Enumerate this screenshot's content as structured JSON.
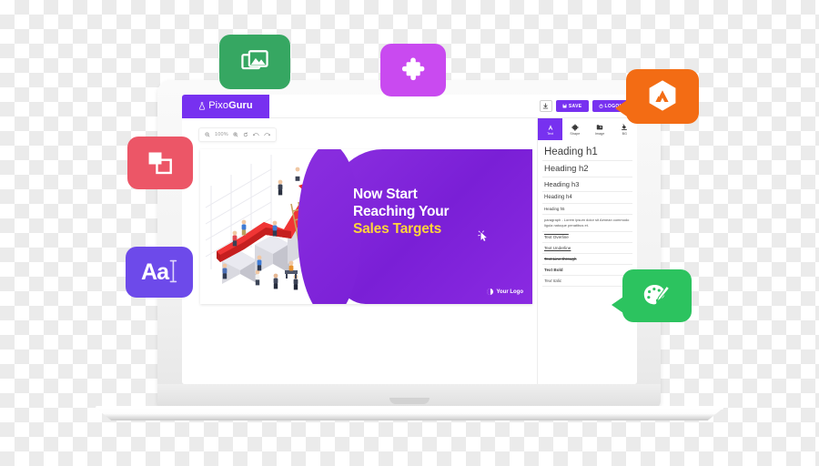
{
  "app": {
    "brand": {
      "name_light": "Pixo",
      "name_bold": "Guru",
      "icon": "flask-icon"
    },
    "topbar": {
      "download_icon": "download-icon",
      "save_label": "SAVE",
      "save_icon": "floppy-icon",
      "logout_label": "LOGOUT",
      "logout_icon": "power-icon",
      "accent": "#7731f0"
    },
    "zoombar": {
      "zoom_out_icon": "zoom-out-icon",
      "zoom_level": "100%",
      "zoom_in_icon": "zoom-in-icon",
      "reset_icon": "reset-rotate-icon",
      "undo_icon": "undo-icon",
      "redo_icon": "redo-icon"
    },
    "panel": {
      "tabs": [
        {
          "label": "Text",
          "icon": "text-a-icon",
          "active": true
        },
        {
          "label": "Shape",
          "icon": "puzzle-icon",
          "active": false
        },
        {
          "label": "Image",
          "icon": "image-icon",
          "active": false
        },
        {
          "label": "BG",
          "icon": "paint-bucket-icon",
          "active": false
        }
      ],
      "styles": [
        {
          "label": "Heading h1"
        },
        {
          "label": "Heading h2"
        },
        {
          "label": "Heading h3"
        },
        {
          "label": "Heading h4"
        },
        {
          "label": "Heading h5"
        },
        {
          "label": "paragraph - Lorem ipsum dolor sit Aenean commodo ligula natoque penatibus et."
        },
        {
          "label": "Text Overline"
        },
        {
          "label": "Text Underline"
        },
        {
          "label": "Text Line-through"
        },
        {
          "label": "Text Bold"
        },
        {
          "label": "Text Italic"
        }
      ]
    },
    "canvas": {
      "heading_line1": "Now Start",
      "heading_line2": "Reaching Your",
      "heading_line3": "Sales Targets",
      "heading_accent_color": "#ffd43b",
      "slide_bg_color": "#8b2fe0",
      "cursor_icon": "click-cursor-icon",
      "logo_placeholder": "Your Logo",
      "illustration": "isometric-growth-arrow-bar-chart-with-business-people"
    }
  },
  "bubbles": [
    {
      "id": "images",
      "icon": "images-icon",
      "color": "#36a762",
      "label": ""
    },
    {
      "id": "puzzle",
      "icon": "puzzle-piece-icon",
      "color": "#c94af0",
      "label": ""
    },
    {
      "id": "shape",
      "icon": "shapes-icon",
      "color": "#ec5667",
      "label": ""
    },
    {
      "id": "text",
      "icon": "text-aa-icon",
      "color": "#6d4aea",
      "label": "Aa"
    },
    {
      "id": "brand",
      "icon": "hexagon-mountain-logo-icon",
      "color": "#f36c14",
      "label": ""
    },
    {
      "id": "palette",
      "icon": "paint-palette-icon",
      "color": "#2cc35f",
      "label": ""
    }
  ]
}
